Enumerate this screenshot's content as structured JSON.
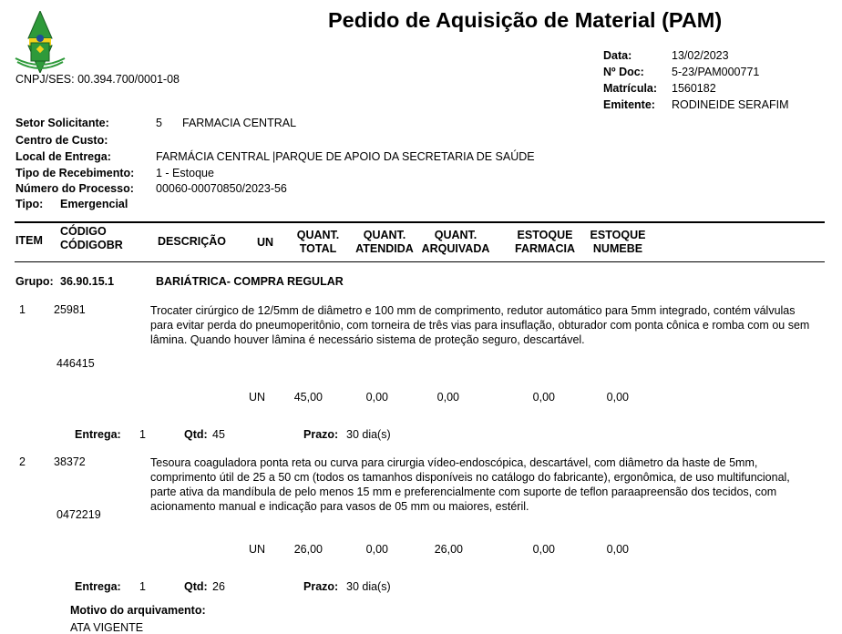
{
  "header": {
    "title": "Pedido de Aquisição de Material (PAM)",
    "cnpj": "CNPJ/SES: 00.394.700/0001-08",
    "meta": [
      {
        "label": "Data:",
        "value": "13/02/2023"
      },
      {
        "label": "Nº Doc:",
        "value": "5-23/PAM000771"
      },
      {
        "label": "Matrícula:",
        "value": "1560182"
      },
      {
        "label": "Emitente:",
        "value": "RODINEIDE SERAFIM"
      }
    ]
  },
  "info": {
    "setor_label": "Setor Solicitante:",
    "setor_code": "5",
    "setor_value": "FARMACIA CENTRAL",
    "centro_label": "Centro de Custo:",
    "local_label": "Local de Entrega:",
    "local_value": "FARMÁCIA CENTRAL |PARQUE DE APOIO DA SECRETARIA DE SAÚDE",
    "receb_label": "Tipo de Recebimento:",
    "receb_value": "1 - Estoque",
    "processo_label": "Número do Processo:",
    "processo_value": "00060-00070850/2023-56",
    "tipo_label": "Tipo:",
    "tipo_value": "Emergencial"
  },
  "columns": {
    "item": "ITEM",
    "codigo_1": "CÓDIGO",
    "codigo_2": "CÓDIGOBR",
    "descricao": "DESCRIÇÃO",
    "un": "UN",
    "qt_total_1": "QUANT.",
    "qt_total_2": "TOTAL",
    "qt_atend_1": "QUANT.",
    "qt_atend_2": "ATENDIDA",
    "qt_arq_1": "QUANT.",
    "qt_arq_2": "ARQUIVADA",
    "est_farm_1": "ESTOQUE",
    "est_farm_2": "FARMACIA",
    "est_num_1": "ESTOQUE",
    "est_num_2": "NUMEBE"
  },
  "group": {
    "label": "Grupo:",
    "code": "36.90.15.1",
    "name": "BARIÁTRICA- COMPRA REGULAR"
  },
  "items": [
    {
      "num": "1",
      "codigo": "25981",
      "codigobr": "446415",
      "descricao": "Trocater cirúrgico de 12/5mm de diâmetro e 100 mm de comprimento, redutor automático para 5mm integrado, contém válvulas para evitar perda do pneumoperitônio, com torneira de três vias para insuflação, obturador com ponta cônica e romba com ou sem lâmina. Quando houver  lâmina é necessário sistema de proteção seguro, descartável.",
      "un": "UN",
      "qt_total": "45,00",
      "qt_atend": "0,00",
      "qt_arq": "0,00",
      "est_farm": "0,00",
      "est_num": "0,00",
      "entrega_label": "Entrega:",
      "entrega": "1",
      "qtd_label": "Qtd:",
      "qtd": "45",
      "prazo_label": "Prazo:",
      "prazo": "30 dia(s)"
    },
    {
      "num": "2",
      "codigo": "38372",
      "codigobr": "0472219",
      "descricao": "Tesoura coaguladora ponta reta ou curva para cirurgia vídeo-endoscópica, descartável, com diâmetro da haste de 5mm, comprimento útil de 25 a 50 cm (todos os tamanhos disponíveis no catálogo do fabricante), ergonômica, de uso multifuncional, parte ativa da mandíbula de pelo menos 15 mm e preferencialmente com suporte de teflon paraapreensão dos tecidos, com acionamento manual e indicação para vasos de 05 mm ou maiores, estéril.",
      "un": "UN",
      "qt_total": "26,00",
      "qt_atend": "0,00",
      "qt_arq": "26,00",
      "est_farm": "0,00",
      "est_num": "0,00",
      "entrega_label": "Entrega:",
      "entrega": "1",
      "qtd_label": "Qtd:",
      "qtd": "26",
      "prazo_label": "Prazo:",
      "prazo": "30 dia(s)",
      "motivo_label": "Motivo do arquivamento:",
      "motivo": "ATA VIGENTE"
    }
  ],
  "colors": {
    "logo_green": "#2e9a3a",
    "logo_yellow": "#f2d21b",
    "logo_blue": "#1e4d9c"
  }
}
